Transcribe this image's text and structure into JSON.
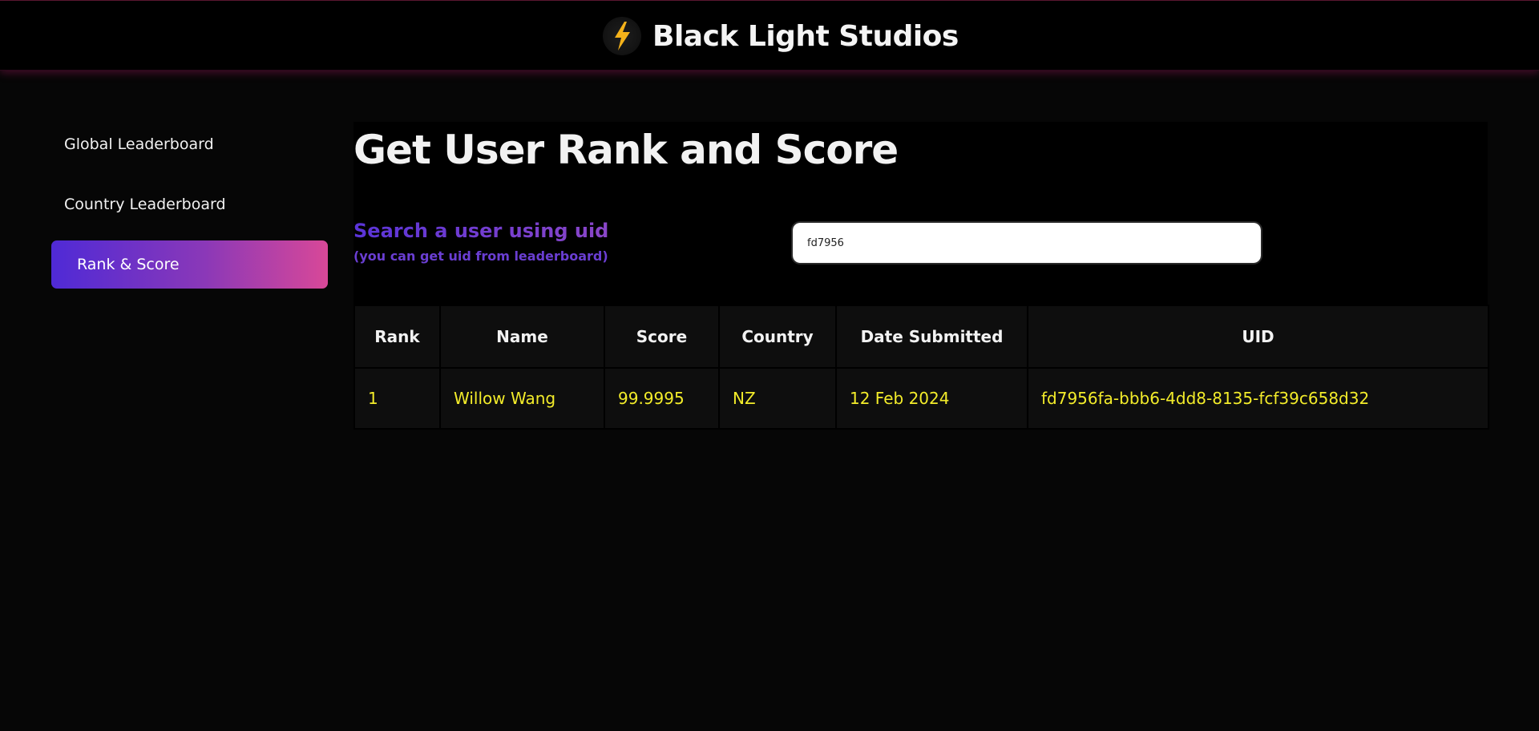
{
  "header": {
    "brand_name": "Black Light Studios",
    "logo_icon": "lightning-bolt-icon",
    "accent_color": "#be1e6e"
  },
  "sidebar": {
    "items": [
      {
        "label": "Global Leaderboard",
        "active": false
      },
      {
        "label": "Country Leaderboard",
        "active": false
      },
      {
        "label": "Rank & Score",
        "active": true
      }
    ],
    "active_gradient": [
      "#4f2ad6",
      "#d84898"
    ]
  },
  "main": {
    "title": "Get User Rank and Score",
    "search": {
      "label": "Search a user using uid",
      "hint": "(you can get uid from leaderboard)",
      "value": "fd7956"
    },
    "table": {
      "columns": [
        "Rank",
        "Name",
        "Score",
        "Country",
        "Date Submitted",
        "UID"
      ],
      "rows": [
        [
          "1",
          "Willow Wang",
          "99.9995",
          "NZ",
          "12 Feb 2024",
          "fd7956fa-bbb6-4dd8-8135-fcf39c658d32"
        ]
      ],
      "value_color": "#f3ec2a"
    }
  }
}
